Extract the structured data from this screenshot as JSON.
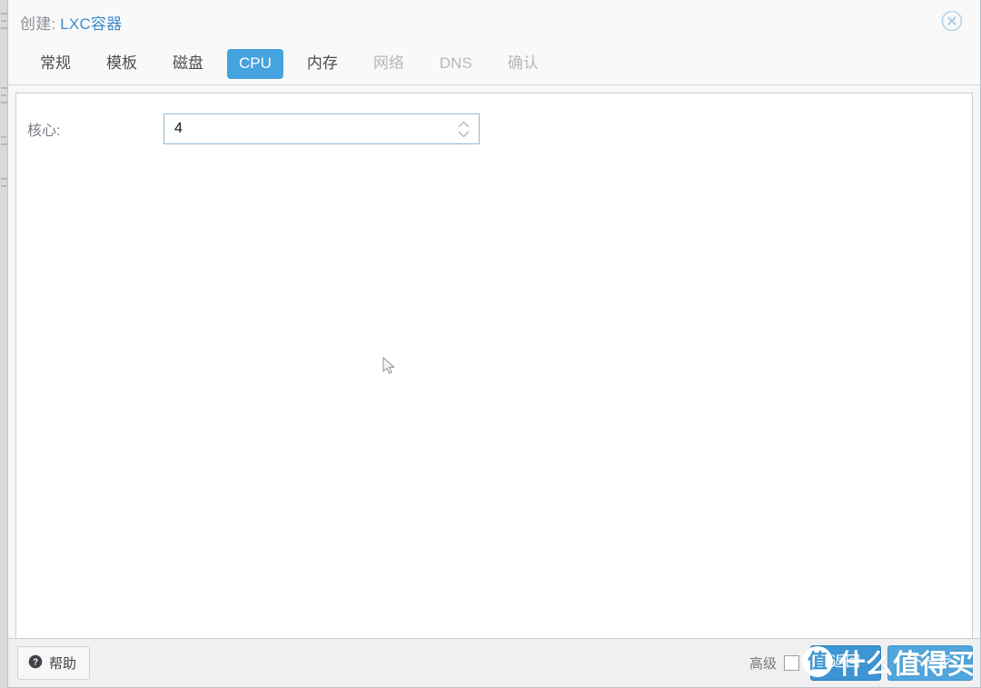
{
  "dialog": {
    "title_prefix": "创建:",
    "title_main": "LXC容器",
    "close_icon": "close-circle-icon"
  },
  "tabs": [
    {
      "label": "常规",
      "state": "enabled"
    },
    {
      "label": "模板",
      "state": "enabled"
    },
    {
      "label": "磁盘",
      "state": "enabled"
    },
    {
      "label": "CPU",
      "state": "active"
    },
    {
      "label": "内存",
      "state": "enabled"
    },
    {
      "label": "网络",
      "state": "disabled"
    },
    {
      "label": "DNS",
      "state": "disabled"
    },
    {
      "label": "确认",
      "state": "disabled"
    }
  ],
  "form": {
    "cores": {
      "label": "核心:",
      "value": "4",
      "placeholder": ""
    }
  },
  "footer": {
    "help_label": "帮助",
    "help_icon": "question-circle-icon",
    "advanced_label": "高级",
    "advanced_checked": false,
    "back_label": "返回",
    "next_label": "下一步"
  },
  "watermark": {
    "badge": "值",
    "text": "什么值得买"
  },
  "colors": {
    "accent_blue": "#3d95d4",
    "tab_active_blue": "#45a3e0",
    "title_blue": "#3e8ccc",
    "label_gray": "#767b82",
    "disabled_gray": "#b4b7bc",
    "input_border": "#8fb9d6",
    "footer_bg": "#f0f0f0"
  }
}
